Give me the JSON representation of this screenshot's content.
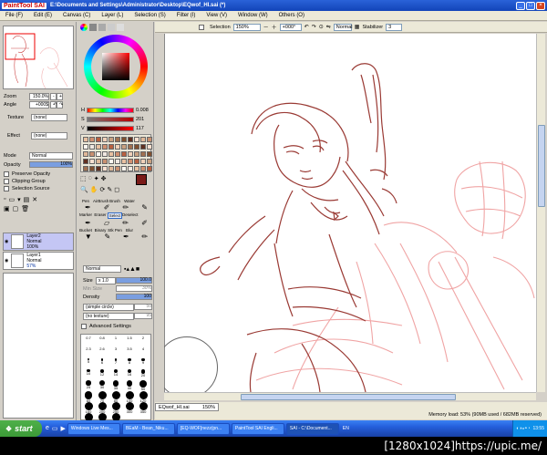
{
  "app": {
    "logo": "PaintTool SAI",
    "title": "E:\\Documents and Settings\\Administrator\\Desktop\\EQwof_HI.sai (*)"
  },
  "menu": [
    "File (F)",
    "Edit (E)",
    "Canvas (C)",
    "Layer (L)",
    "Selection (S)",
    "Filter (I)",
    "View (V)",
    "Window (W)",
    "Others (O)"
  ],
  "navigator": {
    "zoom_label": "Zoom",
    "zoom_value": "150.0%",
    "angle_label": "Angle",
    "angle_value": "+000$"
  },
  "layer_props": {
    "texture_label": "Texture",
    "texture_value": "(none)",
    "effect_label": "Effect",
    "effect_value": "(none)",
    "mode_label": "Mode",
    "mode_value": "Normal",
    "opacity_label": "Opacity",
    "opacity_value": "100%",
    "preserve_opacity": "Preserve Opacity",
    "clipping_group": "Clipping Group",
    "selection_source": "Selection Source"
  },
  "layers": [
    {
      "name": "Layer2",
      "mode": "Normal",
      "opacity": "100%",
      "active": true
    },
    {
      "name": "Layer1",
      "mode": "Normal",
      "opacity": "57%",
      "active": false
    }
  ],
  "hsv": {
    "h_label": "H",
    "h_value": "0.008",
    "s_label": "S",
    "s_value": "201",
    "v_label": "V",
    "v_value": "117"
  },
  "tools": [
    [
      "Pen",
      "AirBrush",
      "Brush",
      "Water"
    ],
    [
      "Marker",
      "Eraser",
      "Select",
      "Deselect"
    ],
    [
      "Bucket",
      "Binary",
      "Stk Pen",
      "Blur"
    ]
  ],
  "brush": {
    "mode_value": "Normal",
    "size_label": "Size",
    "size_mult": "x 1.0",
    "size_value": "100.0",
    "min_size_label": "Min Size",
    "min_size_value": "30%",
    "density_label": "Density",
    "density_value": "100",
    "shape_value": "(simple circle)",
    "shape_amount": "50",
    "texture_value": "(no texture)",
    "texture_amount": "95",
    "advanced": "Advanced Settings"
  },
  "brush_sizes": [
    "0.7",
    "0.8",
    "1",
    "1.5",
    "2",
    "2.3",
    "2.6",
    "3",
    "3.5",
    "4",
    "5",
    "6",
    "7",
    "8",
    "9",
    "10",
    "12",
    "14",
    "16",
    "20",
    "25",
    "30",
    "35",
    "40",
    "50",
    "60",
    "70",
    "80",
    "100",
    "120",
    "160",
    "200",
    "250",
    "300",
    "350",
    "400",
    "450",
    "500"
  ],
  "toolbar": {
    "selection_label": "Selection",
    "zoom_value": "150%",
    "angle_value": "+000°",
    "mode_value": "Normal",
    "stabilizer_label": "Stabilizer",
    "stabilizer_value": "3"
  },
  "doc_tab": {
    "name": "EQwof_HI.sai",
    "zoom": "150%"
  },
  "status": {
    "memory": "Memory load: 53% (90MB used / 682MB reserved)"
  },
  "taskbar": {
    "start": "start",
    "items": [
      "Windows Live Mes...",
      "BEaM - Bean_Niku...",
      "[EQ-WOF]nezz(pn...",
      "PaintTool SAI Engli...",
      "SAI - C:\\Document..."
    ],
    "active_index": 4,
    "lang": "EN",
    "clock": "13:55"
  },
  "watermark": "[1280x1024]https://upic.me/",
  "colors": {
    "sketch": "#9a3a34",
    "light_sketch": "#f0a4a4",
    "main_color": "#7a1a18"
  }
}
